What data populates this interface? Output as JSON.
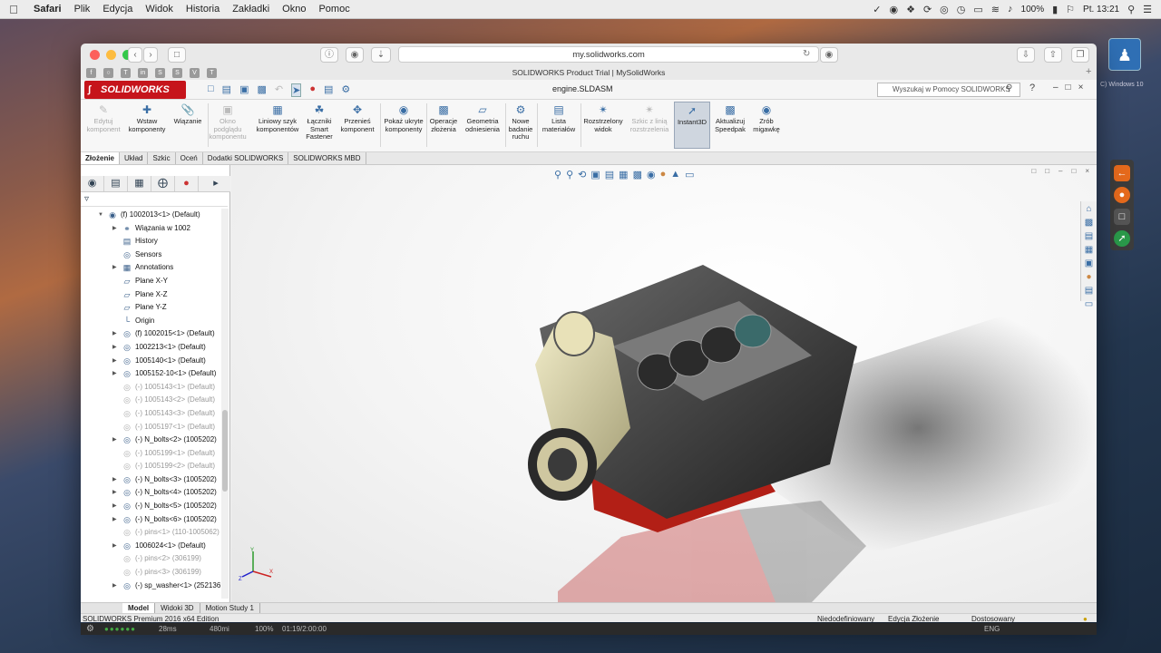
{
  "menubar": {
    "app": "Safari",
    "items": [
      "Plik",
      "Edycja",
      "Widok",
      "Historia",
      "Zakładki",
      "Okno",
      "Pomoc"
    ],
    "battery": "100%",
    "clock": "Pt. 13:21"
  },
  "safari": {
    "url": "my.solidworks.com",
    "page_title": "SOLIDWORKS Product Trial | MySolidWorks"
  },
  "desktop": {
    "label": "C) Windows 10"
  },
  "sw": {
    "logo": "SOLIDWORKS",
    "doc_name": "engine.SLDASM",
    "search_placeholder": "Wyszukaj w Pomocy SOLIDWORKS",
    "ribbon": {
      "edit": "Edytuj komponent",
      "insert": "Wstaw komponenty",
      "mate": "Wiązanie",
      "preview": "Okno podglądu komponentu",
      "linear": "Liniowy szyk komponentów",
      "smart": "Łączniki Smart Fastener",
      "move": "Przenieś komponent",
      "show_hidden": "Pokaż ukryte komponenty",
      "ops": "Operacje złożenia",
      "geom": "Geometria odniesienia",
      "motion": "Nowe badanie ruchu",
      "bom": "Lista materiałów",
      "explode": "Rozstrzelony widok",
      "sketch_line": "Szkic z linią rozstrzelenia",
      "instant3d": "Instant3D",
      "speedpak": "Aktualizuj Speedpak",
      "snapshot": "Zrób migawkę"
    },
    "tabs": [
      "Złożenie",
      "Układ",
      "Szkic",
      "Oceń",
      "Dodatki SOLIDWORKS",
      "SOLIDWORKS MBD"
    ],
    "tree": [
      {
        "label": "(f) 1002013<1> (Default)",
        "level": 0,
        "arrow": "down",
        "icon": "assembly-icon",
        "gray": false
      },
      {
        "label": "Wiązania w 1002",
        "level": 1,
        "arrow": "right",
        "icon": "mates-icon",
        "gray": false
      },
      {
        "label": "History",
        "level": 1,
        "arrow": "",
        "icon": "history-icon",
        "gray": false
      },
      {
        "label": "Sensors",
        "level": 1,
        "arrow": "",
        "icon": "sensor-icon",
        "gray": false
      },
      {
        "label": "Annotations",
        "level": 1,
        "arrow": "right",
        "icon": "annotation-icon",
        "gray": false
      },
      {
        "label": "Plane X-Y",
        "level": 1,
        "arrow": "",
        "icon": "plane-icon",
        "gray": false
      },
      {
        "label": "Plane X-Z",
        "level": 1,
        "arrow": "",
        "icon": "plane-icon",
        "gray": false
      },
      {
        "label": "Plane Y-Z",
        "level": 1,
        "arrow": "",
        "icon": "plane-icon",
        "gray": false
      },
      {
        "label": "Origin",
        "level": 1,
        "arrow": "",
        "icon": "origin-icon",
        "gray": false
      },
      {
        "label": "(f) 1002015<1> (Default)",
        "level": 1,
        "arrow": "right",
        "icon": "part-icon",
        "gray": false
      },
      {
        "label": "1002213<1> (Default)",
        "level": 1,
        "arrow": "right",
        "icon": "part-icon",
        "gray": false
      },
      {
        "label": "1005140<1> (Default)",
        "level": 1,
        "arrow": "right",
        "icon": "part-icon",
        "gray": false
      },
      {
        "label": "1005152-10<1> (Default)",
        "level": 1,
        "arrow": "right",
        "icon": "part-icon",
        "gray": false
      },
      {
        "label": "(-) 1005143<1> (Default)",
        "level": 1,
        "arrow": "",
        "icon": "part-icon",
        "gray": true
      },
      {
        "label": "(-) 1005143<2> (Default)",
        "level": 1,
        "arrow": "",
        "icon": "part-icon",
        "gray": true
      },
      {
        "label": "(-) 1005143<3> (Default)",
        "level": 1,
        "arrow": "",
        "icon": "part-icon",
        "gray": true
      },
      {
        "label": "(-) 1005197<1> (Default)",
        "level": 1,
        "arrow": "",
        "icon": "part-icon",
        "gray": true
      },
      {
        "label": "(-) N_bolts<2> (1005202)",
        "level": 1,
        "arrow": "right",
        "icon": "part-icon",
        "gray": false
      },
      {
        "label": "(-) 1005199<1> (Default)",
        "level": 1,
        "arrow": "",
        "icon": "part-icon",
        "gray": true
      },
      {
        "label": "(-) 1005199<2> (Default)",
        "level": 1,
        "arrow": "",
        "icon": "part-icon",
        "gray": true
      },
      {
        "label": "(-) N_bolts<3> (1005202)",
        "level": 1,
        "arrow": "right",
        "icon": "part-icon",
        "gray": false
      },
      {
        "label": "(-) N_bolts<4> (1005202)",
        "level": 1,
        "arrow": "right",
        "icon": "part-icon",
        "gray": false
      },
      {
        "label": "(-) N_bolts<5> (1005202)",
        "level": 1,
        "arrow": "right",
        "icon": "part-icon",
        "gray": false
      },
      {
        "label": "(-) N_bolts<6> (1005202)",
        "level": 1,
        "arrow": "right",
        "icon": "part-icon",
        "gray": false
      },
      {
        "label": "(-) pins<1> (110-1005062)",
        "level": 1,
        "arrow": "",
        "icon": "part-icon",
        "gray": true
      },
      {
        "label": "1006024<1> (Default)",
        "level": 1,
        "arrow": "right",
        "icon": "part-icon",
        "gray": false
      },
      {
        "label": "(-) pins<2> (306199)",
        "level": 1,
        "arrow": "",
        "icon": "part-icon",
        "gray": true
      },
      {
        "label": "(-) pins<3> (306199)",
        "level": 1,
        "arrow": "",
        "icon": "part-icon",
        "gray": true
      },
      {
        "label": "(-) sp_washer<1> (252136",
        "level": 1,
        "arrow": "right",
        "icon": "part-icon",
        "gray": false
      }
    ],
    "bottom_tabs": [
      "Model",
      "Widoki 3D",
      "Motion Study 1"
    ],
    "status": {
      "edition": "SOLIDWORKS Premium 2016 x64 Edition",
      "defined": "Niedodefiniowany",
      "editing": "Edycja Złożenie",
      "units": "Dostosowany"
    }
  },
  "video_bar": {
    "fps": "28ms",
    "mem": "480mi",
    "zoom": "100%",
    "time": "01:19/2:00:00",
    "lang": "ENG"
  }
}
